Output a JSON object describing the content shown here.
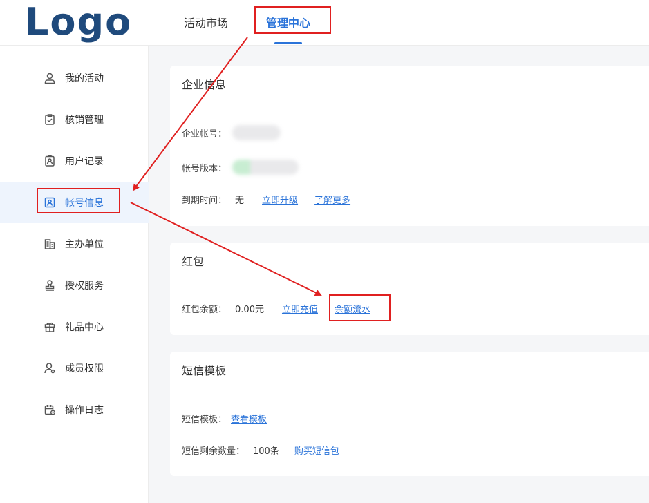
{
  "logo": "Logo",
  "nav": {
    "tabs": [
      {
        "label": "活动市场"
      },
      {
        "label": "管理中心"
      }
    ]
  },
  "sidebar": {
    "items": [
      {
        "label": "我的活动",
        "icon": "user-icon"
      },
      {
        "label": "核销管理",
        "icon": "clipboard-check-icon"
      },
      {
        "label": "用户记录",
        "icon": "user-record-icon"
      },
      {
        "label": "帐号信息",
        "icon": "id-card-icon"
      },
      {
        "label": "主办单位",
        "icon": "building-icon"
      },
      {
        "label": "授权服务",
        "icon": "stamp-icon"
      },
      {
        "label": "礼品中心",
        "icon": "gift-icon"
      },
      {
        "label": "成员权限",
        "icon": "user-gear-icon"
      },
      {
        "label": "操作日志",
        "icon": "calendar-log-icon"
      }
    ]
  },
  "enterprise": {
    "title": "企业信息",
    "account_label": "企业帐号：",
    "version_label": "帐号版本：",
    "expiry_label": "到期时间：",
    "expiry_value": "无",
    "upgrade_link": "立即升级",
    "learn_more_link": "了解更多"
  },
  "redpacket": {
    "title": "红包",
    "balance_label": "红包余额：",
    "balance_value": "0.00元",
    "recharge_link": "立即充值",
    "flow_link": "余额流水"
  },
  "sms": {
    "title": "短信模板",
    "template_label": "短信模板：",
    "view_link": "查看模板",
    "remaining_label": "短信剩余数量：",
    "remaining_value": "100条",
    "buy_link": "购买短信包"
  },
  "colors": {
    "accent": "#2a73d9",
    "logo": "#1f4a7c",
    "highlight": "#e02020"
  }
}
